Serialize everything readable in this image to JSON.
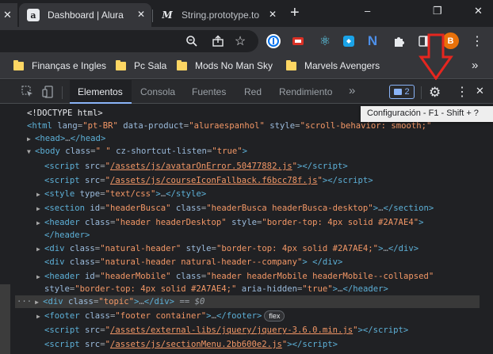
{
  "tabs": [
    {
      "title": "Dashboard | Alura",
      "favicon": "a",
      "active": true
    },
    {
      "title": "String.prototype.to",
      "favicon": "M",
      "active": false
    }
  ],
  "window_controls": {
    "minimize": "–",
    "restore": "❐",
    "close": "✕"
  },
  "new_tab_label": "+",
  "toolbar": {
    "avatar_letter": "B",
    "extension_icons": [
      "zoom-icon",
      "share-icon",
      "bookmark-star-icon",
      "onepassword-icon",
      "extension-red-icon",
      "react-devtools-icon",
      "extension-teal-icon",
      "n-extension-icon",
      "puzzle-icon",
      "menu-dots-icon"
    ]
  },
  "bookmarks": [
    {
      "label": "Finanças e Ingles"
    },
    {
      "label": "Pc Sala"
    },
    {
      "label": "Mods No Man Sky"
    },
    {
      "label": "Marvels Avengers"
    }
  ],
  "bookmarks_overflow": "»",
  "devtools": {
    "tabs": [
      "Elementos",
      "Consola",
      "Fuentes",
      "Red",
      "Rendimiento"
    ],
    "active_tab": "Elementos",
    "more_tabs": "»",
    "issues_count": "2",
    "settings_tooltip": "Configuración - F1 - Shift + ?"
  },
  "dom_tree": {
    "doctype": "<!DOCTYPE html>",
    "html_lang": "pt-BR",
    "html_product": "aluraespanhol",
    "html_style": "scroll-behavior: smooth;",
    "body_class": " ",
    "body_attr": "cz-shortcut-listen",
    "body_attr_val": "true",
    "script1": "/assets/js/avatarOnError.50477882.js",
    "script2": "/assets/js/courseIconFallback.f6bcc78f.js",
    "style_type": "text/css",
    "section_id": "headerBusca",
    "section_class": "headerBusca headerBusca-desktop",
    "header_class": "header headerDesktop",
    "header_style": "border-top: 4px solid #2A7AE4",
    "div1_class": "natural-header",
    "div1_style": "border-top: 4px solid #2A7AE4;",
    "div2_class": "natural-header natural-header--company",
    "header2_id": "headerMobile",
    "header2_class": "header headerMobile headerMobile--collapsed",
    "header2_style": "border-top: 4px solid #2A7AE4;",
    "header2_aria": "true",
    "topic_class": "topic",
    "selected_marker": "== $0",
    "footer_class": "footer container",
    "footer_badge": "flex",
    "script3": "/assets/external-libs/jquery/jquery-3.6.0.min.js",
    "script4": "/assets/js/sectionMenu.2bb600e2.js"
  }
}
